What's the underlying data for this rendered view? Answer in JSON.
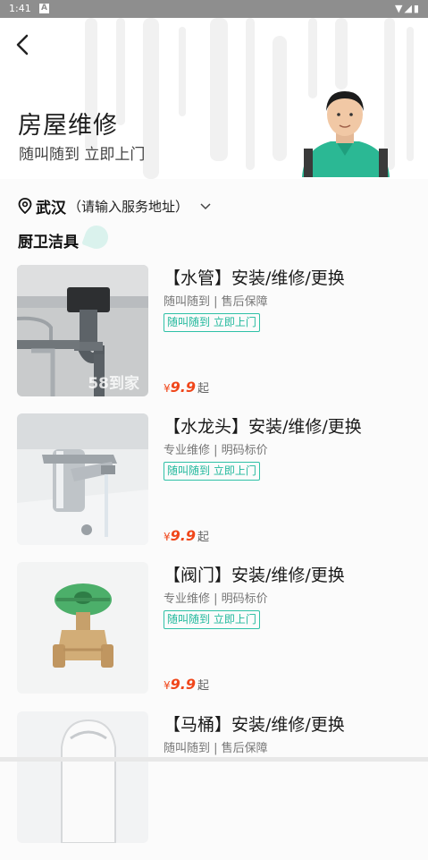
{
  "status_bar": {
    "time": "1:41",
    "badge": "A",
    "icons": "▼◢▮"
  },
  "header": {
    "back_icon": "chevron-left-icon",
    "title": "房屋维修",
    "subtitle": "随叫随到 立即上门"
  },
  "location": {
    "city": "武汉",
    "hint": "（请输入服务地址）"
  },
  "section": {
    "title": "厨卫洁具"
  },
  "items": [
    {
      "title": "【水管】安装/维修/更换",
      "desc": "随叫随到 | 售后保障",
      "tag": "随叫随到 立即上门",
      "price_symbol": "¥",
      "price": "9.9",
      "price_suffix": "起",
      "watermark": "58到家"
    },
    {
      "title": "【水龙头】安装/维修/更换",
      "desc": "专业维修 | 明码标价",
      "tag": "随叫随到 立即上门",
      "price_symbol": "¥",
      "price": "9.9",
      "price_suffix": "起"
    },
    {
      "title": "【阀门】安装/维修/更换",
      "desc": "专业维修 | 明码标价",
      "tag": "随叫随到 立即上门",
      "price_symbol": "¥",
      "price": "9.9",
      "price_suffix": "起"
    },
    {
      "title": "【马桶】安装/维修/更换",
      "desc": "随叫随到 | 售后保障"
    }
  ],
  "colors": {
    "accent": "#20b89c",
    "price": "#f0461a",
    "status_bar": "#8e8e8e"
  }
}
